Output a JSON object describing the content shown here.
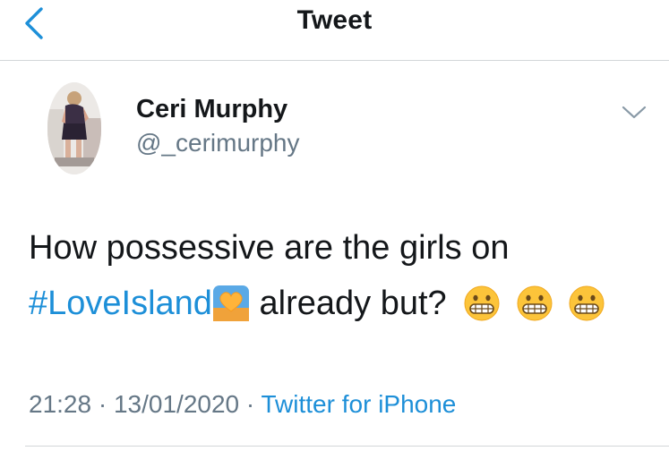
{
  "nav": {
    "title": "Tweet",
    "back_icon": "chevron-left-icon"
  },
  "tweet": {
    "author": {
      "display_name": "Ceri Murphy",
      "username": "@_cerimurphy"
    },
    "text_line1": "How possessive are the girls on",
    "hashtag": "#LoveIsland",
    "text_line2_rest": "already but?",
    "emojis": [
      "grimacing-face-emoji",
      "grimacing-face-emoji",
      "grimacing-face-emoji"
    ],
    "hashtag_emoji": "heart-sunset-emoji",
    "time": "21:28",
    "date": "13/01/2020",
    "separator": "·",
    "source": "Twitter for iPhone"
  },
  "colors": {
    "link": "#1d8fd8",
    "secondary_text": "#657786",
    "divider": "#d3d6d9"
  }
}
